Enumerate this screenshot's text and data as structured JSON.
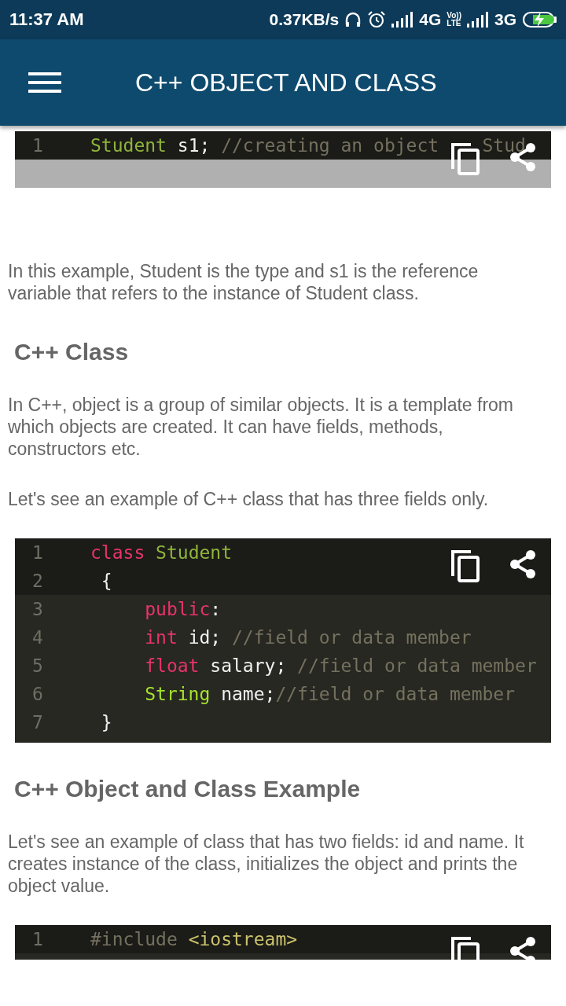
{
  "status_bar": {
    "time": "11:37 AM",
    "speed": "0.37KB/s",
    "network_1": "4G",
    "volte": [
      "Vo))",
      "LTE"
    ],
    "network_2": "3G"
  },
  "app_bar": {
    "title": "C++ OBJECT AND CLASS"
  },
  "content": [
    {
      "kind": "code",
      "scrollbar": true,
      "lines": [
        {
          "number": "1",
          "highlighted": true,
          "tokens": [
            {
              "kind": "type",
              "text": "Student"
            },
            {
              "kind": "plain",
              "text": " s1;"
            },
            {
              "kind": "comment",
              "text": " //creating an object"
            },
            {
              "kind": "comment",
              "text": "    Stud"
            }
          ]
        }
      ]
    },
    {
      "kind": "paragraph",
      "text": "In this example, Student is the type and s1 is the reference variable that refers to the instance of Student class."
    },
    {
      "kind": "heading",
      "text": "C++ Class"
    },
    {
      "kind": "paragraph",
      "text": "In C++, object is a group of similar objects. It is a template from which objects are created. It can have fields, methods, constructors etc."
    },
    {
      "kind": "paragraph",
      "text": "Let's see an example of C++ class that has three fields only."
    },
    {
      "kind": "code",
      "scrollbar": false,
      "lines": [
        {
          "number": "1",
          "highlighted": true,
          "tokens": [
            {
              "kind": "keyword",
              "text": "class"
            },
            {
              "kind": "type",
              "text": " Student"
            }
          ]
        },
        {
          "number": "2",
          "highlighted": true,
          "tokens": [
            {
              "kind": "plain",
              "text": " {"
            }
          ]
        },
        {
          "number": "3",
          "highlighted": false,
          "tokens": [
            {
              "kind": "keyword",
              "text": "     public"
            },
            {
              "kind": "plain",
              "text": ":"
            }
          ]
        },
        {
          "number": "4",
          "highlighted": false,
          "tokens": [
            {
              "kind": "keyword",
              "text": "     int"
            },
            {
              "kind": "plain",
              "text": " id;"
            },
            {
              "kind": "comment",
              "text": " //field or data member"
            }
          ]
        },
        {
          "number": "5",
          "highlighted": false,
          "tokens": [
            {
              "kind": "keyword",
              "text": "     float"
            },
            {
              "kind": "plain",
              "text": " salary;"
            },
            {
              "kind": "comment",
              "text": " //field or data member"
            }
          ]
        },
        {
          "number": "6",
          "highlighted": false,
          "tokens": [
            {
              "kind": "type2",
              "text": "     String"
            },
            {
              "kind": "plain",
              "text": " name;"
            },
            {
              "kind": "comment",
              "text": "//field or data member"
            }
          ]
        },
        {
          "number": "7",
          "highlighted": false,
          "tokens": [
            {
              "kind": "plain",
              "text": " }"
            }
          ]
        }
      ]
    },
    {
      "kind": "heading",
      "text": "C++ Object and Class Example"
    },
    {
      "kind": "paragraph",
      "text": "Let's see an example of class that has two fields: id and name. It creates instance of the class, initializes the object and prints the object value."
    },
    {
      "kind": "code",
      "scrollbar": false,
      "lines": [
        {
          "number": "1",
          "highlighted": true,
          "tokens": [
            {
              "kind": "preproc",
              "text": "#include"
            },
            {
              "kind": "string",
              "text": " <iostream>"
            }
          ]
        }
      ]
    }
  ]
}
